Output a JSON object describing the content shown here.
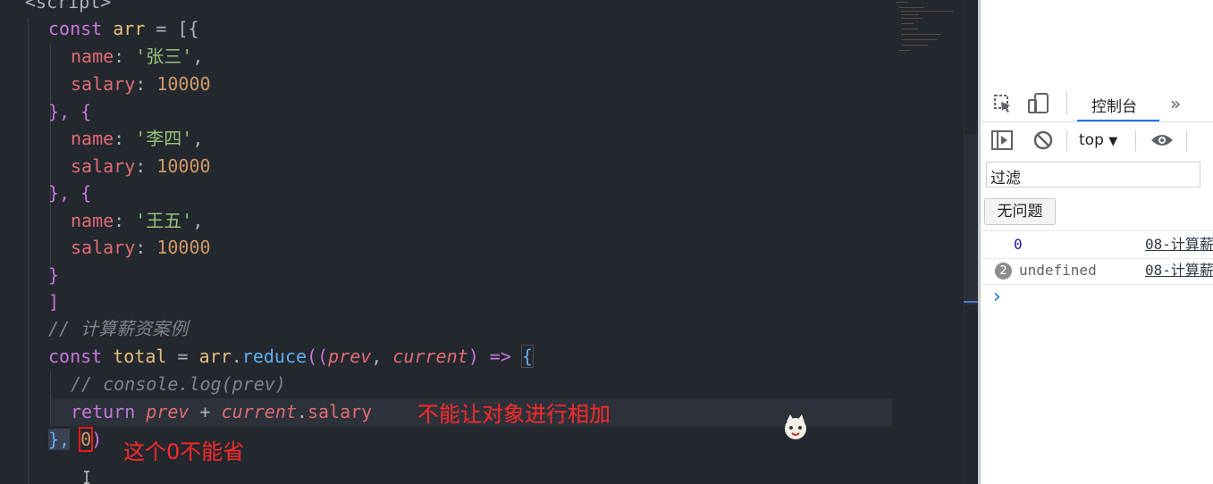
{
  "editor": {
    "lines": {
      "l0": "<script>",
      "l1_kw": "const",
      "l1_name": "arr",
      "l1_rest": " = [{",
      "l2_prop": "name",
      "l2_str": "'张三'",
      "l3_prop": "salary",
      "l3_num": "10000",
      "l4": "}, {",
      "l5_prop": "name",
      "l5_str": "'李四'",
      "l6_prop": "salary",
      "l6_num": "10000",
      "l7": "}, {",
      "l8_prop": "name",
      "l8_str": "'王五'",
      "l9_prop": "salary",
      "l9_num": "10000",
      "l10": "}",
      "l11": "]",
      "l12": "// 计算薪资案例",
      "l13_kw": "const",
      "l13_name": "total",
      "l13_eq": " = ",
      "l13_arr": "arr",
      "l13_fn": "reduce",
      "l13_p1": "prev",
      "l13_p2": "current",
      "l13_arrow": "=>",
      "l14": "// console.log(prev)",
      "l15_kw": "return",
      "l15_p1": "prev",
      "l15_p2": "current",
      "l15_prop": "salary",
      "l16_close": "},",
      "l16_num": "0",
      "l16_paren": ")"
    },
    "annotations": {
      "no_add_objects": "不能让对象进行相加",
      "zero_required": "这个0不能省"
    }
  },
  "devtools": {
    "tab_console": "控制台",
    "more_tabs": "»",
    "context": "top",
    "filter_placeholder": "过滤",
    "issues_button": "无问题",
    "messages": [
      {
        "text": "0",
        "source": "08-计算薪"
      },
      {
        "count": "2",
        "text": "undefined",
        "source": "08-计算薪"
      }
    ],
    "prompt": "›"
  }
}
